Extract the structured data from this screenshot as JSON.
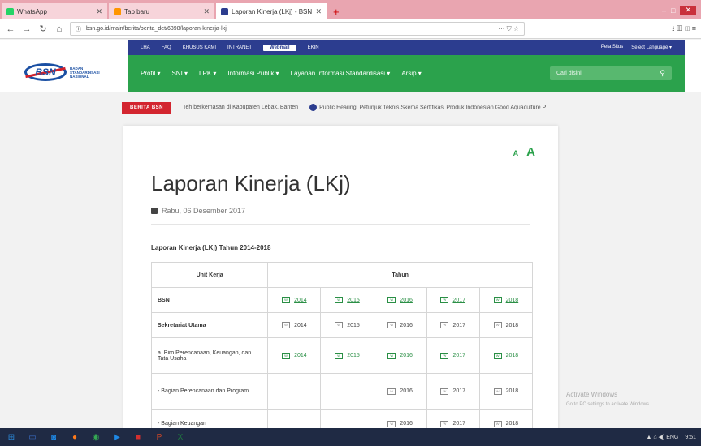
{
  "browser": {
    "tabs": [
      {
        "title": "WhatsApp",
        "color": "#25d366",
        "active": false
      },
      {
        "title": "Tab baru",
        "color": "#ff9500",
        "active": false
      },
      {
        "title": "Laporan Kinerja (LKj) - BSN - Badan Standardisasi Nasional",
        "color": "#2c3d8f",
        "active": true
      }
    ],
    "new_tab": "+",
    "window_controls": {
      "minimize": "–",
      "maximize": "□",
      "close": "✕"
    },
    "url": "bsn.go.id/main/berita/berita_det/6398/laporan-kinerja-lkj",
    "url_tools": "⋯ ⛉ ☆",
    "toolbar_icons": "⭳ ▥ ◫ ≡"
  },
  "site": {
    "logo_text": "BSN",
    "logo_subtitle": "BADAN STANDARDISASI NASIONAL",
    "topmenu": [
      "LHA",
      "FAQ",
      "KHUSUS KAMI",
      "INTRANET",
      "Webmail",
      "EKIN"
    ],
    "topmenu_right": [
      "Peta Situs",
      "Select Language ▾"
    ],
    "mainmenu": [
      "Profil ▾",
      "SNI ▾",
      "LPK ▾",
      "Informasi Publik ▾",
      "Layanan Informasi Standardisasi ▾",
      "Arsip ▾"
    ],
    "search_placeholder": "Cari disini",
    "ticker_label": "BERITA BSN",
    "ticker_items": [
      "Teh berkemasan di Kabupaten Lebak, Banten",
      "Public Hearing: Petunjuk Teknis Skema Sertifikasi Produk Indonesian Good Aquaculture P"
    ]
  },
  "article": {
    "font_small": "A",
    "font_large": "A",
    "title": "Laporan Kinerja (LKj)",
    "date": "Rabu, 06 Desember 2017",
    "caption": "Laporan Kinerja (LKj) Tahun 2014-2018",
    "table": {
      "header_unit": "Unit Kerja",
      "header_year": "Tahun",
      "doc_icon_label": "W",
      "rows": [
        {
          "unit": "BSN",
          "bold": true,
          "years": [
            {
              "y": "2014",
              "link": true
            },
            {
              "y": "2015",
              "link": true
            },
            {
              "y": "2016",
              "link": true
            },
            {
              "y": "2017",
              "link": true
            },
            {
              "y": "2018",
              "link": true
            }
          ]
        },
        {
          "unit": "Sekretariat Utama",
          "bold": true,
          "years": [
            {
              "y": "2014",
              "link": false
            },
            {
              "y": "2015",
              "link": false
            },
            {
              "y": "2016",
              "link": false
            },
            {
              "y": "2017",
              "link": false
            },
            {
              "y": "2018",
              "link": false
            }
          ]
        },
        {
          "unit": "a. Biro Perencanaan, Keuangan, dan Tata Usaha",
          "bold": false,
          "years": [
            {
              "y": "2014",
              "link": true
            },
            {
              "y": "2015",
              "link": true
            },
            {
              "y": "2016",
              "link": true
            },
            {
              "y": "2017",
              "link": true
            },
            {
              "y": "2018",
              "link": true
            }
          ]
        },
        {
          "unit": "- Bagian Perencanaan dan Program",
          "bold": false,
          "years": [
            null,
            null,
            {
              "y": "2016",
              "link": false
            },
            {
              "y": "2017",
              "link": false
            },
            {
              "y": "2018",
              "link": false
            }
          ]
        },
        {
          "unit": "- Bagian Keuangan",
          "bold": false,
          "years": [
            null,
            null,
            {
              "y": "2016",
              "link": false
            },
            {
              "y": "2017",
              "link": false
            },
            {
              "y": "2018",
              "link": false
            }
          ]
        }
      ]
    }
  },
  "watermark": {
    "line1": "Activate Windows",
    "line2": "Go to PC settings to activate Windows."
  },
  "taskbar": {
    "items": [
      {
        "name": "start",
        "glyph": "⊞",
        "color": "#2b8de0"
      },
      {
        "name": "task-view",
        "glyph": "▭",
        "color": "#3a6fc9"
      },
      {
        "name": "app1",
        "glyph": "◙",
        "color": "#1e88e5"
      },
      {
        "name": "firefox",
        "glyph": "●",
        "color": "#ff7a1a"
      },
      {
        "name": "chrome",
        "glyph": "◉",
        "color": "#34a853"
      },
      {
        "name": "media",
        "glyph": "▶",
        "color": "#1e88e5"
      },
      {
        "name": "acrobat",
        "glyph": "■",
        "color": "#d32f2f"
      },
      {
        "name": "powerpoint",
        "glyph": "P",
        "color": "#d24726"
      },
      {
        "name": "excel",
        "glyph": "X",
        "color": "#1f7a3e"
      }
    ],
    "tray_text": "▲ ⌂ ◀) ENG",
    "clock": "9:51"
  }
}
